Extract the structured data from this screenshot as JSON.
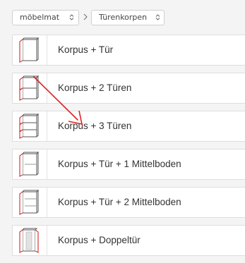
{
  "breadcrumb": {
    "items": [
      {
        "label": "möbelmat"
      },
      {
        "label": "Türenkorpen"
      }
    ]
  },
  "list": {
    "items": [
      {
        "label": "Korpus + Tür"
      },
      {
        "label": "Korpus + 2 Türen"
      },
      {
        "label": "Korpus + 3 Türen"
      },
      {
        "label": "Korpus + Tür + 1 Mittelboden"
      },
      {
        "label": "Korpus + Tür + 2 Mittelboden"
      },
      {
        "label": "Korpus + Doppeltür"
      }
    ]
  },
  "colors": {
    "outline": "#555555",
    "door": "#d93a3a",
    "annotation_arrow": "#e02020"
  }
}
